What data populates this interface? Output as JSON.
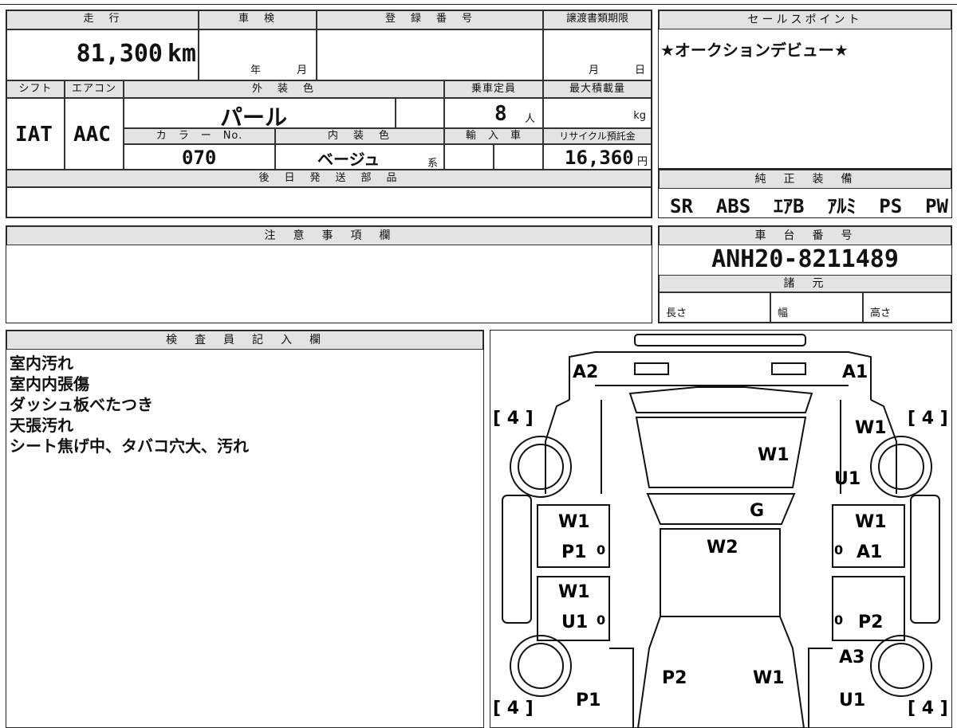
{
  "top_table": {
    "mileage": {
      "label": "走　行",
      "value": "81,300",
      "unit": "km"
    },
    "shaken": {
      "label": "車　検",
      "year_unit": "年",
      "month_unit": "月"
    },
    "registration": {
      "label": "登　録　番　号",
      "value": ""
    },
    "transfer_deadline": {
      "label": "譲渡書類期限",
      "month_unit": "月",
      "day_unit": "日"
    },
    "shift": {
      "label": "シフト",
      "value": "IAT"
    },
    "aircon": {
      "label": "エアコン",
      "value": "AAC"
    },
    "exterior_color": {
      "label": "外　装　色",
      "value": "パール"
    },
    "capacity": {
      "label": "乗車定員",
      "value": "8",
      "unit": "人"
    },
    "max_load": {
      "label": "最大積載量",
      "unit": "kg"
    },
    "color_no": {
      "label": "カ　ラ　ー　No.",
      "value": "070"
    },
    "interior_color": {
      "label": "内　装　色",
      "value": "ベージュ",
      "suffix": "系"
    },
    "import": {
      "label": "輸　入　車"
    },
    "recycle": {
      "label": "リサイクル預託金",
      "value": "16,360",
      "unit": "円"
    },
    "later_parts": {
      "label": "後　日　発　送　部　品",
      "value": ""
    }
  },
  "sales_point": {
    "label": "セールスポイント",
    "text": "★オークションデビュー★"
  },
  "genuine_equipment": {
    "label": "純　正　装　備",
    "value": "SR  ABS  ｴｱB  ｱﾙﾐ  PS  PW"
  },
  "caution": {
    "label": "注　意　事　項　欄",
    "value": ""
  },
  "chassis": {
    "label": "車　台　番　号",
    "value": "ANH20-8211489"
  },
  "specs": {
    "label": "諸　元",
    "length": "長さ",
    "width": "幅",
    "height": "高さ"
  },
  "inspector": {
    "label": "検　査　員　記　入　欄",
    "notes": [
      "室内汚れ",
      "室内内張傷",
      "ダッシュ板べたつき",
      "天張汚れ",
      "シート焦げ中、タバコ穴大、汚れ"
    ]
  },
  "diagram": {
    "tire_values": [
      "[ 4 ]",
      "[ 4 ]",
      "[ 4 ]",
      "[ 4 ]"
    ],
    "marks": {
      "a2": "A2",
      "a1_front": "A1",
      "w1_front_right": "W1",
      "w1_hood": "W1",
      "u1_front_right": "U1",
      "g": "G",
      "w1_door_fl": "W1",
      "p1_door_fl": "P1",
      "w2_roof": "W2",
      "w1_door_fr": "W1",
      "a1_door_fr": "A1",
      "w1_door_rl": "W1",
      "u1_door_rl": "U1",
      "p2_door_rr": "P2",
      "a3_rear_right": "A3",
      "p2_rear": "P2",
      "w1_rear": "W1",
      "p1_rear_left": "P1",
      "u1_rear_right": "U1",
      "zero1": "0",
      "zero2": "0",
      "zero3": "0",
      "zero4": "0"
    }
  }
}
